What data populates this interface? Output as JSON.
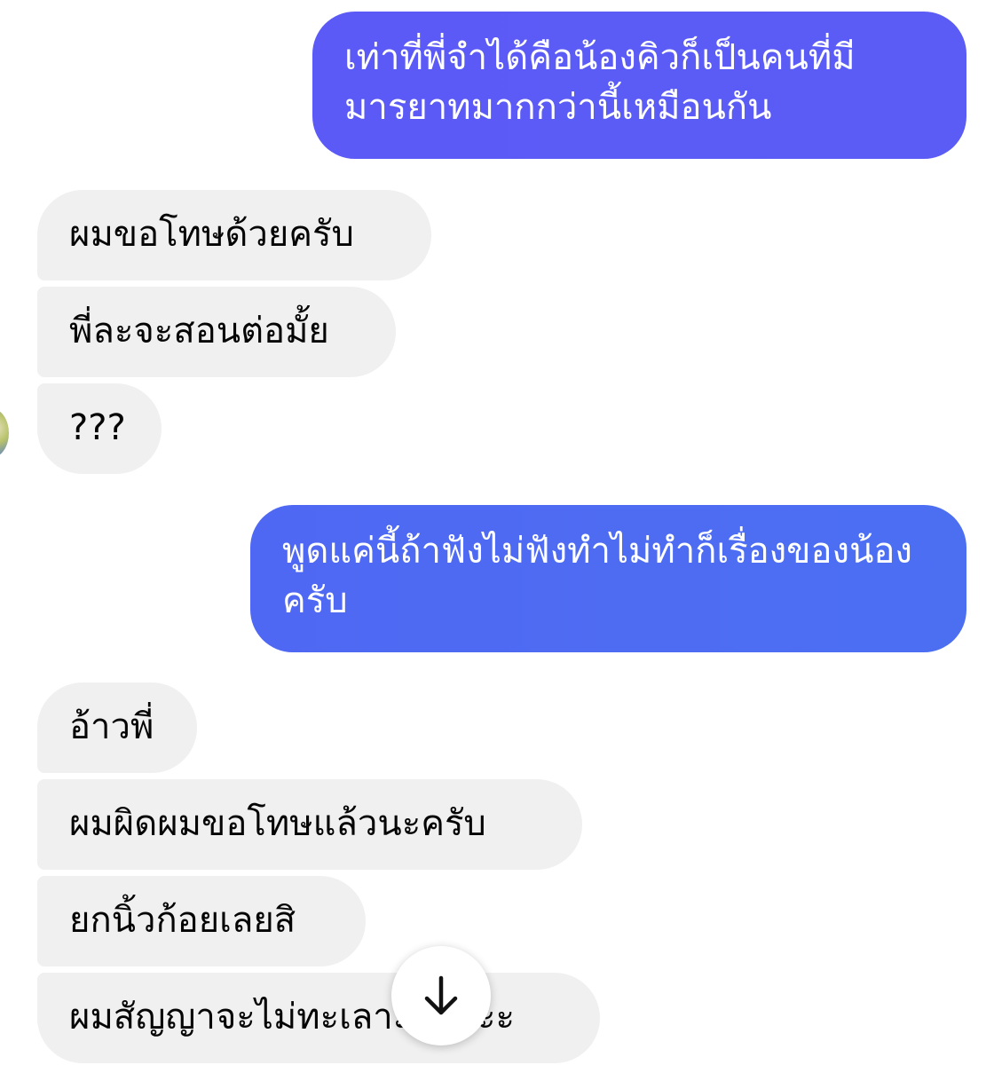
{
  "colors": {
    "sent_bubble_1": "#5b5bf6",
    "sent_bubble_2": "#4d6cf2",
    "received_bubble": "#f0f0f0",
    "received_text": "#050505",
    "sent_text": "#ffffff"
  },
  "messages": [
    {
      "side": "sent",
      "text": "เท่าที่พี่จำได้คือน้องคิวก็เป็นคนที่มีมารยาทมากกว่านี้เหมือนกัน"
    },
    {
      "side": "received",
      "text": "ผมขอโทษด้วยครับ"
    },
    {
      "side": "received",
      "text": "พี่ละจะสอนต่อมั้ย"
    },
    {
      "side": "received",
      "text": "???"
    },
    {
      "side": "sent",
      "text": "พูดแค่นี้ถ้าฟังไม่ฟังทำไม่ทำก็เรื่องของน้องครับ"
    },
    {
      "side": "received",
      "text": "อ้าวพี่"
    },
    {
      "side": "received",
      "text": "ผมผิดผมขอโทษแล้วนะครับ"
    },
    {
      "side": "received",
      "text": "ยกนิ้วก้อยเลยสิ"
    },
    {
      "side": "received",
      "text": "ผมสัญญาจะไม่ทะเลาะอีกละะ"
    }
  ],
  "scroll_button": {
    "icon": "arrow-down-icon"
  }
}
